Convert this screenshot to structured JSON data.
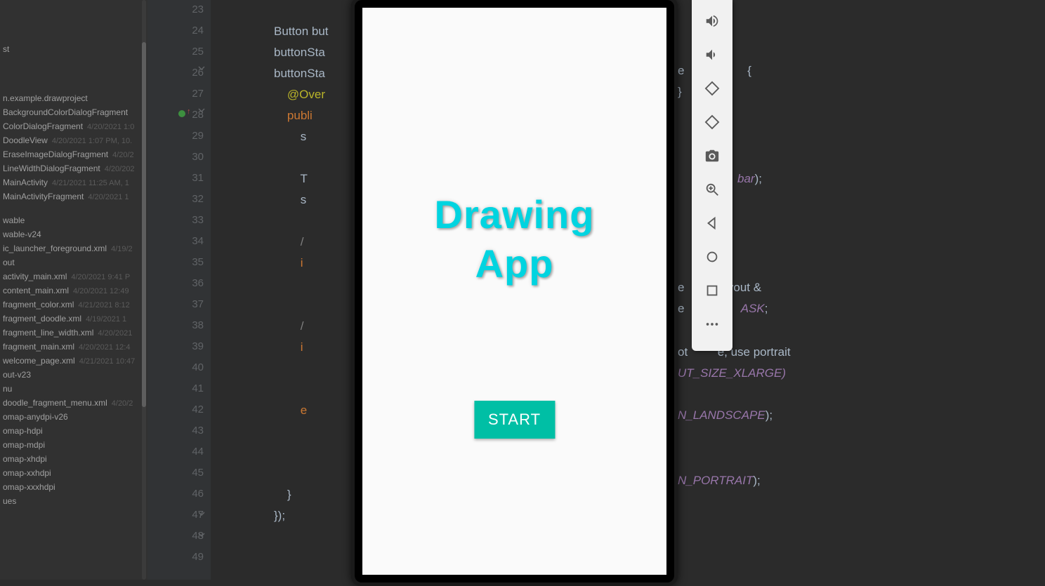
{
  "project": {
    "root": "st",
    "pkg": "n.example.drawproject",
    "classes": [
      {
        "n": "BackgroundColorDialogFragment",
        "t": ""
      },
      {
        "n": "ColorDialogFragment",
        "t": "4/20/2021 1:0"
      },
      {
        "n": "DoodleView",
        "t": "4/20/2021 1:07 PM, 10."
      },
      {
        "n": "EraseImageDialogFragment",
        "t": "4/20/2"
      },
      {
        "n": "LineWidthDialogFragment",
        "t": "4/20/202"
      },
      {
        "n": "MainActivity",
        "t": "4/21/2021 11:25 AM, 1"
      },
      {
        "n": "MainActivityFragment",
        "t": "4/20/2021 1"
      }
    ],
    "draw": [
      "wable",
      "wable-v24"
    ],
    "ic": {
      "n": "ic_launcher_foreground.xml",
      "t": "4/19/2"
    },
    "layoutHeader": "out",
    "layouts": [
      {
        "n": "activity_main.xml",
        "t": "4/20/2021 9:41 P"
      },
      {
        "n": "content_main.xml",
        "t": "4/20/2021 12:49"
      },
      {
        "n": "fragment_color.xml",
        "t": "4/21/2021 8:12"
      },
      {
        "n": "fragment_doodle.xml",
        "t": "4/19/2021 1"
      },
      {
        "n": "fragment_line_width.xml",
        "t": "4/20/2021"
      },
      {
        "n": "fragment_main.xml",
        "t": "4/20/2021 12:4"
      },
      {
        "n": "welcome_page.xml",
        "t": "4/21/2021 10:47"
      }
    ],
    "menuHeader": "nu",
    "layout23": "out-v23",
    "menu": {
      "n": "doodle_fragment_menu.xml",
      "t": "4/20/2"
    },
    "mip": [
      "omap-anydpi-v26",
      "omap-hdpi",
      "omap-mdpi",
      "omap-xhdpi",
      "omap-xxhdpi",
      "omap-xxxhdpi"
    ],
    "ues": "ues"
  },
  "code": {
    "lines": [
      23,
      24,
      25,
      26,
      27,
      28,
      29,
      30,
      31,
      32,
      33,
      34,
      35,
      36,
      37,
      38,
      39,
      40,
      41,
      42,
      43,
      44,
      45,
      46,
      47,
      48,
      49
    ],
    "btnDecl": "Button but",
    "btnSta1": "buttonSta",
    "btnSta2": "buttonSta",
    "override": "@Over",
    "publi": "publi",
    "s1": "s",
    "toolbar": "T",
    "setSup": "s",
    "comment1": "/",
    "if1": "i",
    "comment2": "/",
    "if2": "i",
    "else": "e",
    "closeBrace": "}",
    "closeParen": "});",
    "tail_23": "",
    "tail_bar": "bar);",
    "tail_brace": "{",
    "tail_close": "}",
    "tail_yout": "yout &",
    "tail_ask": "ASK;",
    "tail_portrait": "e, use portrait",
    "tail_xlarge": "UT_SIZE_XLARGE)",
    "tail_land": "N_LANDSCAPE);",
    "tail_port": "N_PORTRAIT);"
  },
  "app": {
    "title_l1": "Drawing",
    "title_l2": "App",
    "start": "START"
  },
  "emulator": {
    "icons": [
      "volume-up",
      "volume-down",
      "rotate-left",
      "rotate-right",
      "camera",
      "zoom",
      "back",
      "home",
      "overview",
      "more"
    ]
  }
}
